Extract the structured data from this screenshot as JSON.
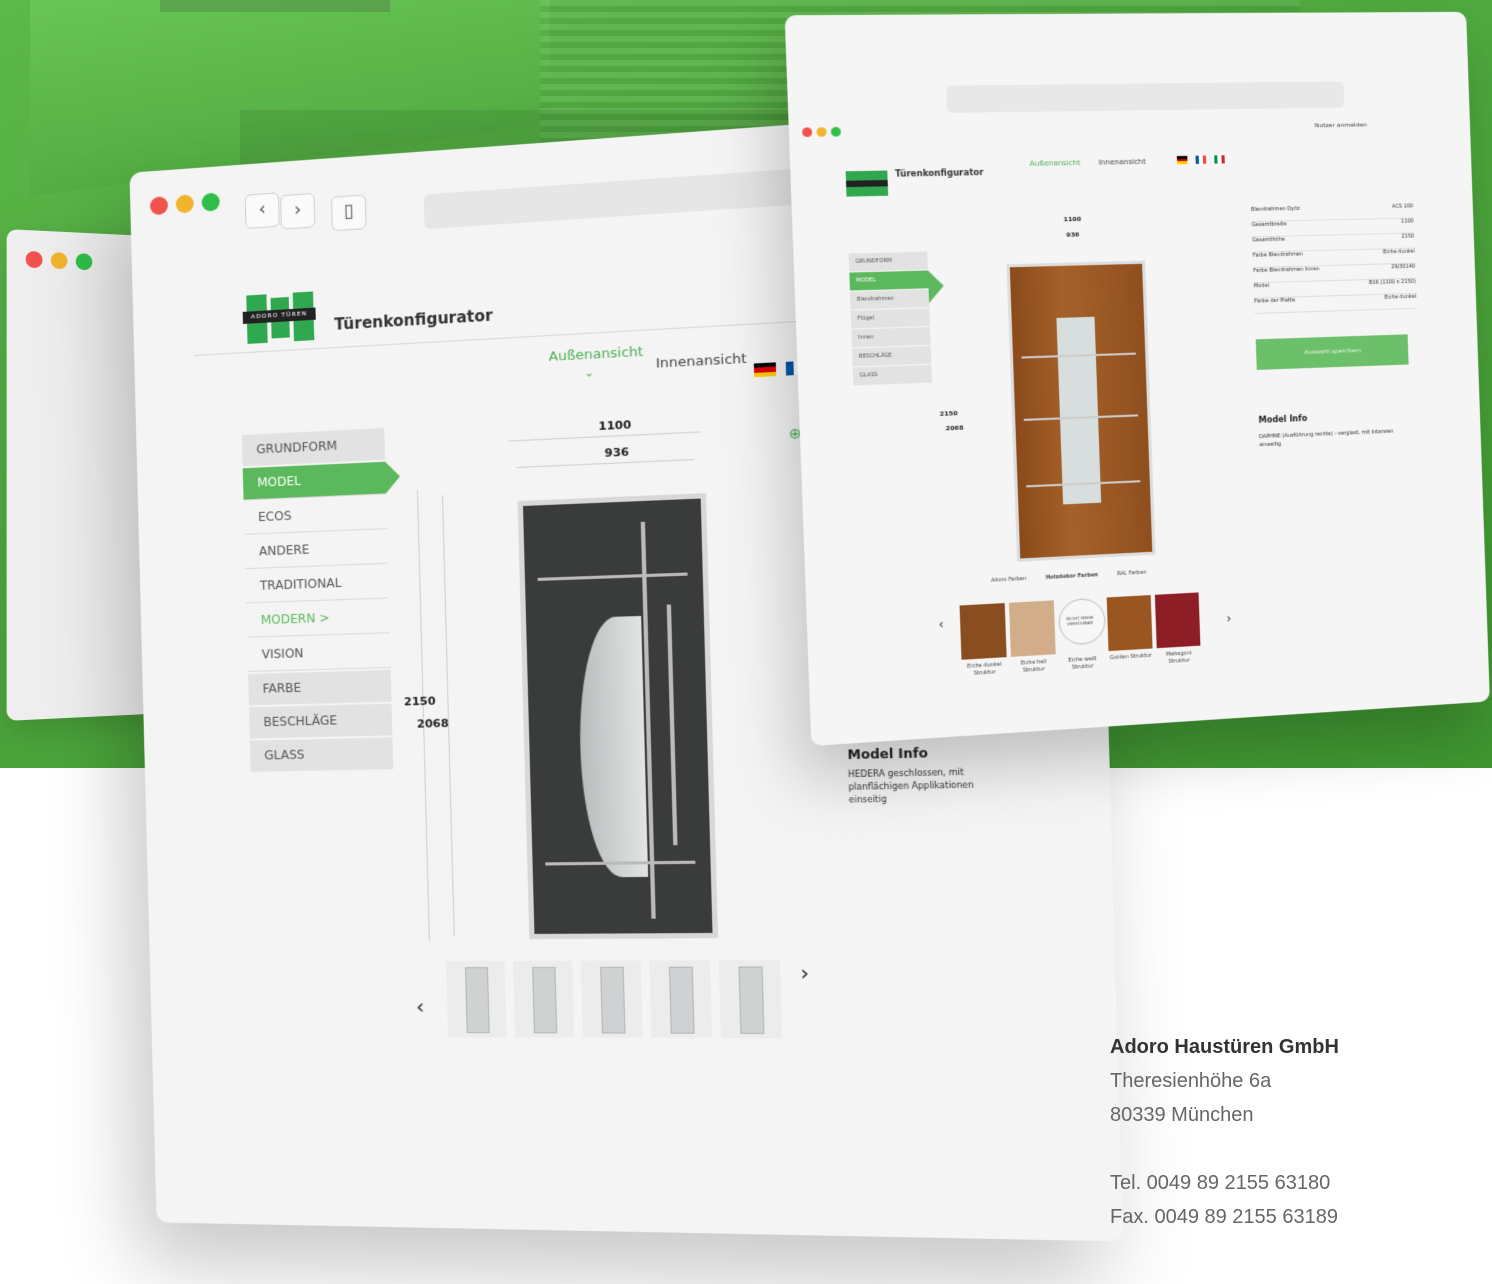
{
  "main_window": {
    "app_title": "Türenkonfigurator",
    "logo_text": "ADORO TÜREN",
    "tabs": {
      "outer": "Außenansicht",
      "inner": "Innenansicht"
    },
    "menu": [
      {
        "label": "GRUNDFORM",
        "style": "gray"
      },
      {
        "label": "MODEL",
        "style": "active"
      },
      {
        "label": "ECOS",
        "style": "plain"
      },
      {
        "label": "ANDERE",
        "style": "plain"
      },
      {
        "label": "TRADITIONAL",
        "style": "plain"
      },
      {
        "label": "MODERN >",
        "style": "green"
      },
      {
        "label": "VISION",
        "style": "plain"
      },
      {
        "label": "FARBE",
        "style": "gray"
      },
      {
        "label": "BESCHLÄGE",
        "style": "gray"
      },
      {
        "label": "GLASS",
        "style": "gray"
      }
    ],
    "dimensions": {
      "width_outer": "1100",
      "width_inner": "936",
      "height_outer": "2150",
      "height_inner": "2068"
    },
    "model_info": {
      "title": "Model Info",
      "text": "HEDERA geschlossen, mit planflächigen Applikationen einseitig"
    },
    "colors": {
      "accent": "#5cb85c",
      "door": "#3a3b3b"
    }
  },
  "right_window": {
    "app_title": "Türenkonfigurator",
    "login": "Nutzer anmelden",
    "tabs": {
      "outer": "Außenansicht",
      "inner": "Innenansicht"
    },
    "menu": [
      "GRUNDFORM",
      "MODEL",
      "Blendrahmen",
      "Flügel",
      "Innen",
      "BESCHLÄGE",
      "GLASS"
    ],
    "dimensions": {
      "width_outer": "1100",
      "width_inner": "936",
      "height_outer": "2150",
      "height_inner": "2068"
    },
    "specs": [
      {
        "label": "Blendrahmen Dyöz",
        "value": "ACS 100"
      },
      {
        "label": "Gesamtbreite",
        "value": "1100"
      },
      {
        "label": "Gesamthöhe",
        "value": "2150"
      },
      {
        "label": "Farbe Blendrahmen",
        "value": "Eiche dunkel"
      },
      {
        "label": "Farbe Blendrahmen Innen",
        "value": "29/30140"
      },
      {
        "label": "Model",
        "value": "B16 (1100 x 2150)"
      },
      {
        "label": "Farbe der Platte",
        "value": "Eiche dunkel"
      }
    ],
    "save_button": "Auswahl speichern",
    "model_info": {
      "title": "Model Info",
      "text": "DAPHNE (Ausführung rechts) - verglast, mit Intarsien einseitig"
    },
    "color_tabs": [
      "Adoro Farben",
      "Holzdekor Farben",
      "RAL Farben"
    ],
    "swatches": [
      {
        "label": "Eiche dunkel Struktur",
        "color": "#8a4d1f"
      },
      {
        "label": "Eiche hell Struktur",
        "color": "#d1ad8a"
      },
      {
        "label": "Eiche weiß Struktur",
        "color": "#f7f7f7"
      },
      {
        "label": "Golden Struktur",
        "color": "#9a5620"
      },
      {
        "label": "Mahagoni Struktur",
        "color": "#8e1e25"
      }
    ],
    "swatch_badge": "NICHT MEHR VERFÜGBAR",
    "door_color": "#9a5622"
  },
  "company": {
    "name": "Adoro Haustüren GmbH",
    "street": "Theresienhöhe 6a",
    "city": "80339 München",
    "tel": "Tel.  0049 89 2155 63180",
    "fax": "Fax. 0049 89 2155 63189"
  }
}
